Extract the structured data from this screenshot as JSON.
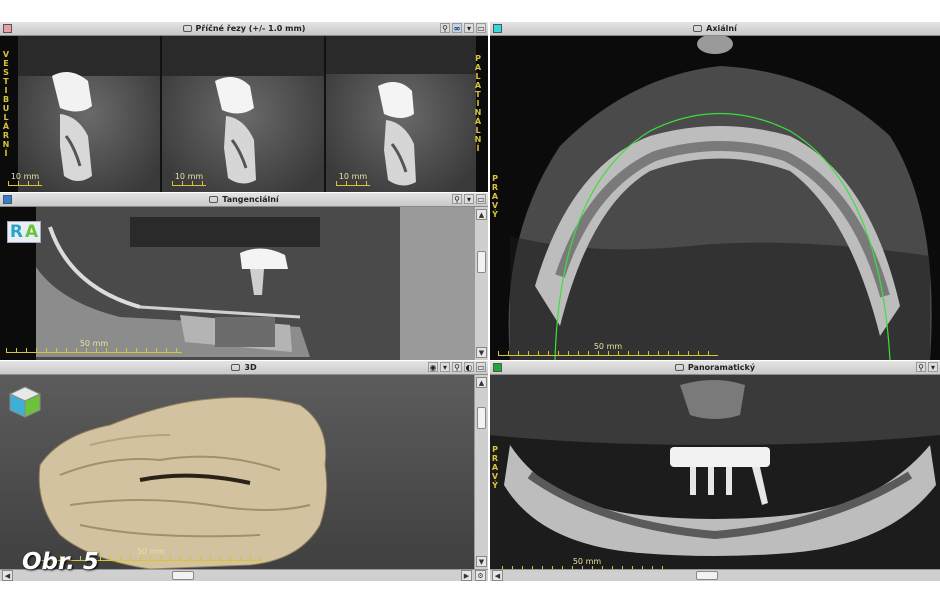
{
  "panels": {
    "cross_sections": {
      "title": "Příčné řezy (+/- 1.0 mm)",
      "color": "#e8a0a6",
      "side_left": "VESTIBULÁRNÍ",
      "side_right": "PALATINÁLNÍ",
      "scale_labels": [
        "10 mm",
        "10 mm",
        "10 mm"
      ]
    },
    "tangential": {
      "title": "Tangenciální",
      "color": "#2f7fd6",
      "badge": [
        "R",
        "A"
      ],
      "scale_label": "50 mm"
    },
    "view3d": {
      "title": "3D",
      "color": "#9a9a9a",
      "scale_label": "50 mm"
    },
    "axial": {
      "title": "Axiální",
      "color": "#35d8e0",
      "side_label": "PRAVÝ",
      "scale_label": "50 mm"
    },
    "panoramic": {
      "title": "Panoramatický",
      "color": "#1fa83a",
      "side_label": "PRAVÝ",
      "scale_label": "50 mm"
    }
  },
  "figure_label": "Obr. 5",
  "icons": [
    "camera-icon",
    "magnify-icon",
    "link-icon",
    "dropdown-icon",
    "maximize-icon",
    "eye-icon",
    "toggle-icon",
    "gear-icon",
    "chevron-up-icon",
    "chevron-down-icon",
    "chevron-left-icon",
    "chevron-right-icon",
    "orientation-cube-icon"
  ]
}
